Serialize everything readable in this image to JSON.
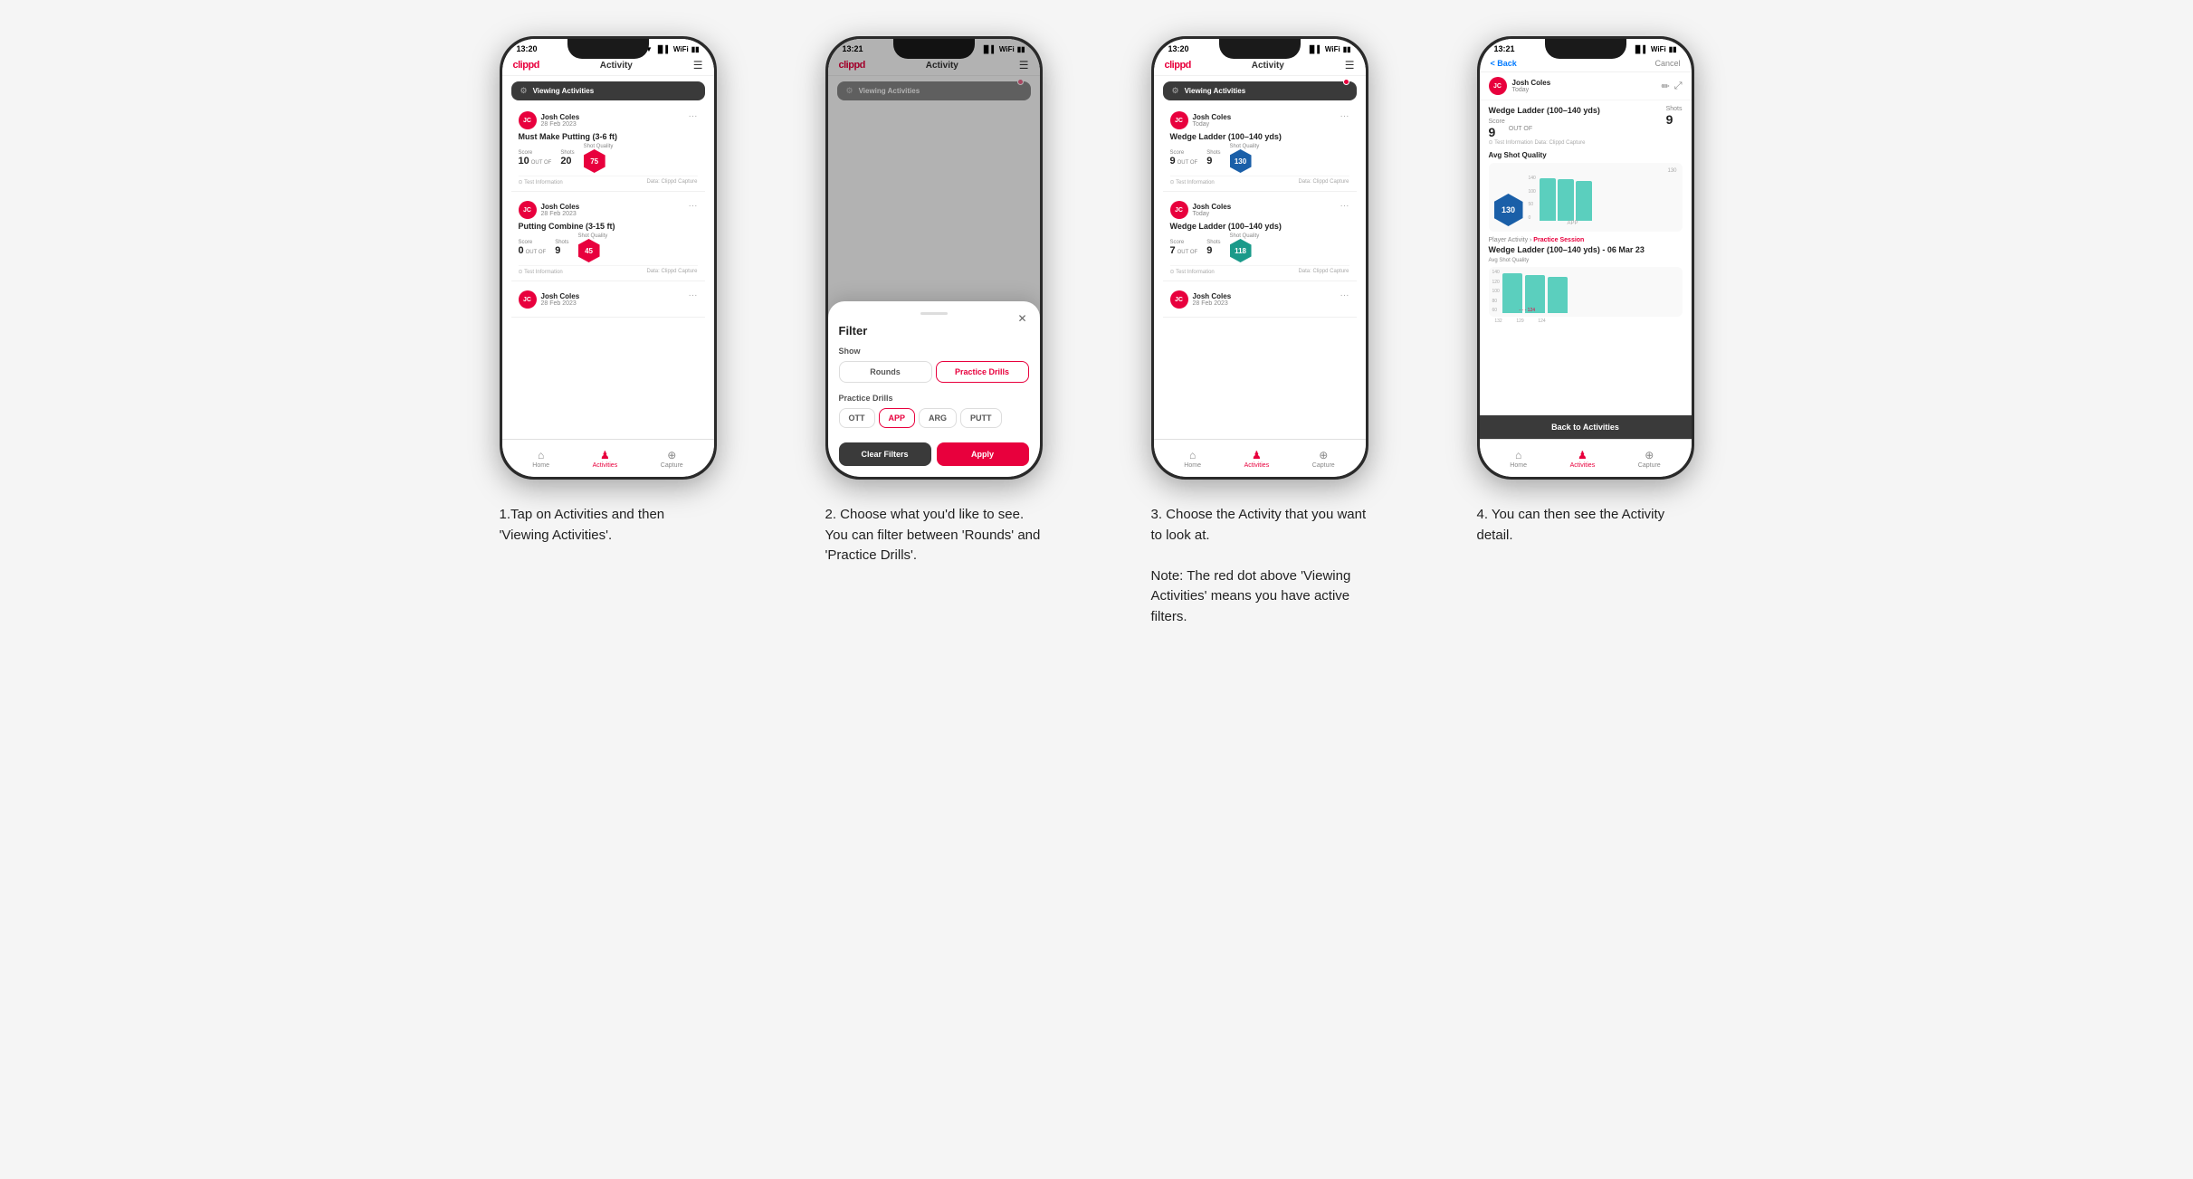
{
  "phones": [
    {
      "id": "phone1",
      "statusBar": {
        "time": "13:20",
        "icons": "▲ ▼ 📶 📶 🔋"
      },
      "header": {
        "logo": "clippd",
        "title": "Activity",
        "menuIcon": "☰"
      },
      "viewingBar": {
        "label": "Viewing Activities",
        "hasDot": false,
        "filterIcon": "⚙"
      },
      "cards": [
        {
          "userName": "Josh Coles",
          "userDate": "28 Feb 2023",
          "avatarInitials": "JC",
          "title": "Must Make Putting (3-6 ft)",
          "scoreLabel": "Score",
          "scoreValue": "10",
          "shotsLabel": "Shots",
          "shotsValue": "20",
          "shotQualityLabel": "Shot Quality",
          "shotQualityValue": "75",
          "badgeColor": "red",
          "footerLeft": "⊙ Test Information",
          "footerRight": "Data: Clippd Capture"
        },
        {
          "userName": "Josh Coles",
          "userDate": "28 Feb 2023",
          "avatarInitials": "JC",
          "title": "Putting Combine (3-15 ft)",
          "scoreLabel": "Score",
          "scoreValue": "0",
          "shotsLabel": "Shots",
          "shotsValue": "9",
          "shotQualityLabel": "Shot Quality",
          "shotQualityValue": "45",
          "badgeColor": "red",
          "footerLeft": "⊙ Test Information",
          "footerRight": "Data: Clippd Capture"
        },
        {
          "userName": "Josh Coles",
          "userDate": "28 Feb 2023",
          "avatarInitials": "JC",
          "title": "",
          "scoreLabel": "",
          "scoreValue": "",
          "shotsLabel": "",
          "shotsValue": "",
          "shotQualityLabel": "",
          "shotQualityValue": "",
          "badgeColor": "red",
          "footerLeft": "",
          "footerRight": ""
        }
      ],
      "nav": [
        {
          "icon": "⌂",
          "label": "Home",
          "active": false
        },
        {
          "icon": "♟",
          "label": "Activities",
          "active": true
        },
        {
          "icon": "⊕",
          "label": "Capture",
          "active": false
        }
      ]
    },
    {
      "id": "phone2",
      "statusBar": {
        "time": "13:21",
        "icons": "▲ ▼ 📶 📶 🔋"
      },
      "header": {
        "logo": "clippd",
        "title": "Activity",
        "menuIcon": "☰"
      },
      "viewingBar": {
        "label": "Viewing Activities",
        "hasDot": true,
        "filterIcon": "⚙"
      },
      "filterModal": {
        "title": "Filter",
        "showLabel": "Show",
        "toggles": [
          {
            "label": "Rounds",
            "active": false
          },
          {
            "label": "Practice Drills",
            "active": true
          }
        ],
        "practiceDrillsLabel": "Practice Drills",
        "drillButtons": [
          {
            "label": "OTT",
            "active": false
          },
          {
            "label": "APP",
            "active": true
          },
          {
            "label": "ARG",
            "active": false
          },
          {
            "label": "PUTT",
            "active": false
          }
        ],
        "clearLabel": "Clear Filters",
        "applyLabel": "Apply"
      },
      "nav": [
        {
          "icon": "⌂",
          "label": "Home",
          "active": false
        },
        {
          "icon": "♟",
          "label": "Activities",
          "active": true
        },
        {
          "icon": "⊕",
          "label": "Capture",
          "active": false
        }
      ]
    },
    {
      "id": "phone3",
      "statusBar": {
        "time": "13:20",
        "icons": "▲ ▼ 📶 📶 🔋"
      },
      "header": {
        "logo": "clippd",
        "title": "Activity",
        "menuIcon": "☰"
      },
      "viewingBar": {
        "label": "Viewing Activities",
        "hasDot": true,
        "filterIcon": "⚙"
      },
      "cards": [
        {
          "userName": "Josh Coles",
          "userDate": "Today",
          "avatarInitials": "JC",
          "title": "Wedge Ladder (100–140 yds)",
          "scoreLabel": "Score",
          "scoreValue": "9",
          "shotsLabel": "Shots",
          "shotsValue": "9",
          "shotQualityLabel": "Shot Quality",
          "shotQualityValue": "130",
          "badgeColor": "blue",
          "footerLeft": "⊙ Test Information",
          "footerRight": "Data: Clippd Capture"
        },
        {
          "userName": "Josh Coles",
          "userDate": "Today",
          "avatarInitials": "JC",
          "title": "Wedge Ladder (100–140 yds)",
          "scoreLabel": "Score",
          "scoreValue": "7",
          "shotsLabel": "Shots",
          "shotsValue": "9",
          "shotQualityLabel": "Shot Quality",
          "shotQualityValue": "118",
          "badgeColor": "teal",
          "footerLeft": "⊙ Test Information",
          "footerRight": "Data: Clippd Capture"
        },
        {
          "userName": "Josh Coles",
          "userDate": "28 Feb 2023",
          "avatarInitials": "JC",
          "title": "",
          "scoreLabel": "",
          "scoreValue": "",
          "shotsLabel": "",
          "shotsValue": "",
          "shotQualityLabel": "",
          "shotQualityValue": "",
          "badgeColor": "red",
          "footerLeft": "",
          "footerRight": ""
        }
      ],
      "nav": [
        {
          "icon": "⌂",
          "label": "Home",
          "active": false
        },
        {
          "icon": "♟",
          "label": "Activities",
          "active": true
        },
        {
          "icon": "⊕",
          "label": "Capture",
          "active": false
        }
      ]
    },
    {
      "id": "phone4",
      "statusBar": {
        "time": "13:21",
        "icons": "▲ ▼ 📶 📶 🔋"
      },
      "backLabel": "< Back",
      "cancelLabel": "Cancel",
      "user": {
        "name": "Josh Coles",
        "date": "Today",
        "initials": "JC"
      },
      "detail": {
        "drillTitle": "Wedge Ladder (100–140 yds)",
        "scoreLabel": "Score",
        "scoreValue": "9",
        "outOfLabel": "OUT OF",
        "shotsLabel": "Shots",
        "shotsValue": "9",
        "testInfo": "⊙ Test Information    Data: Clippd Capture",
        "avgShotQualityLabel": "Avg Shot Quality",
        "hexValue": "130",
        "chartValues": [
          132,
          129,
          124
        ],
        "chartLabels": [
          "",
          "",
          "APP"
        ],
        "chartMax": 140,
        "yLabels": [
          "140",
          "100",
          "50",
          "0"
        ],
        "playerActivityLabel": "Player Activity",
        "practiceSessionLabel": "Practice Session",
        "drillTitle2": "Wedge Ladder (100–140 yds) - 06 Mar 23",
        "avgShotQualityLabel2": "Avg Shot Quality",
        "bars": [
          {
            "value": 132,
            "label": ""
          },
          {
            "value": 129,
            "label": ""
          },
          {
            "value": 124,
            "label": "APP"
          }
        ],
        "backToActivities": "Back to Activities"
      },
      "nav": [
        {
          "icon": "⌂",
          "label": "Home",
          "active": false
        },
        {
          "icon": "♟",
          "label": "Activities",
          "active": true
        },
        {
          "icon": "⊕",
          "label": "Capture",
          "active": false
        }
      ]
    }
  ],
  "captions": [
    "1.Tap on Activities and then 'Viewing Activities'.",
    "2. Choose what you'd like to see. You can filter between 'Rounds' and 'Practice Drills'.",
    "3. Choose the Activity that you want to look at.\n\nNote: The red dot above 'Viewing Activities' means you have active filters.",
    "4. You can then see the Activity detail."
  ]
}
